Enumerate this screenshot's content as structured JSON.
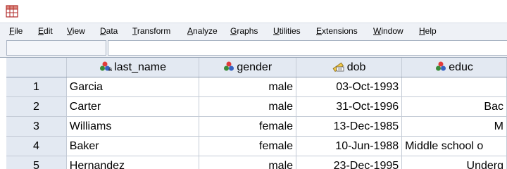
{
  "menu": [
    {
      "label": "File"
    },
    {
      "label": "Edit"
    },
    {
      "label": "View"
    },
    {
      "label": "Data"
    },
    {
      "label": "Transform"
    },
    {
      "label": "Analyze"
    },
    {
      "label": "Graphs"
    },
    {
      "label": "Utilities"
    },
    {
      "label": "Extensions"
    },
    {
      "label": "Window"
    },
    {
      "label": "Help"
    }
  ],
  "columns": [
    {
      "name": "last_name",
      "icon": "nominal-string-icon"
    },
    {
      "name": "gender",
      "icon": "nominal-icon"
    },
    {
      "name": "dob",
      "icon": "scale-date-icon"
    },
    {
      "name": "educ",
      "icon": "nominal-icon"
    }
  ],
  "rows": [
    {
      "num": "1",
      "last_name": "Garcia",
      "gender": "male",
      "dob": "03-Oct-1993",
      "educ": ""
    },
    {
      "num": "2",
      "last_name": "Carter",
      "gender": "male",
      "dob": "31-Oct-1996",
      "educ": "Bac"
    },
    {
      "num": "3",
      "last_name": "Williams",
      "gender": "female",
      "dob": "13-Dec-1985",
      "educ": "M"
    },
    {
      "num": "4",
      "last_name": "Baker",
      "gender": "female",
      "dob": "10-Jun-1988",
      "educ": "Middle school o"
    },
    {
      "num": "5",
      "last_name": "Hernandez",
      "gender": "male",
      "dob": "23-Dec-1995",
      "educ": "Underg"
    }
  ],
  "colors": {
    "accent": "#e3e9f2",
    "grid_line": "#c4cbd6"
  }
}
